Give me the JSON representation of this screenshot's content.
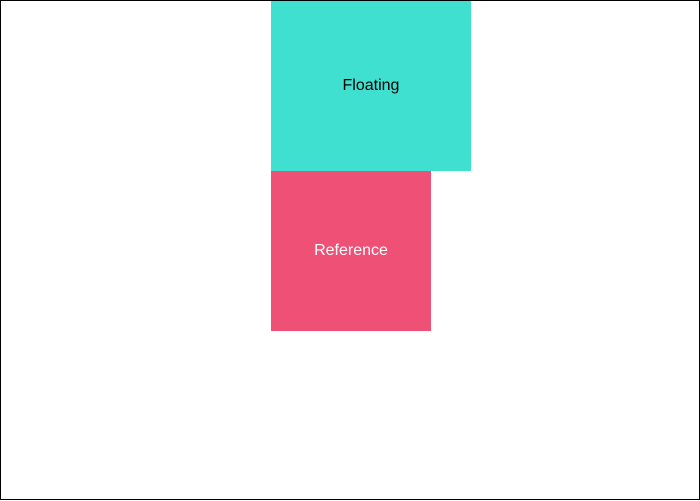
{
  "floating": {
    "label": "Floating",
    "background": "#40e0d0",
    "text_color": "#000000"
  },
  "reference": {
    "label": "Reference",
    "background": "#ef5075",
    "text_color": "#ffffff"
  },
  "container": {
    "border_color": "#000000",
    "background": "#ffffff"
  }
}
